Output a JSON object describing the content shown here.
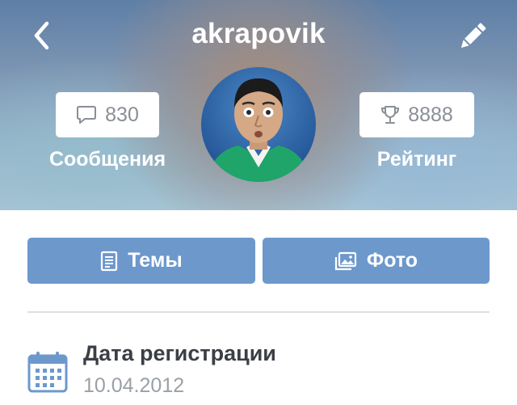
{
  "profile": {
    "username": "akrapovik"
  },
  "stats": {
    "messages": {
      "count": "830",
      "label": "Сообщения",
      "icon": "speech-bubble-icon"
    },
    "rating": {
      "count": "8888",
      "label": "Рейтинг",
      "icon": "trophy-icon"
    }
  },
  "tabs": [
    {
      "label": "Темы",
      "icon": "document-icon"
    },
    {
      "label": "Фото",
      "icon": "photo-icon"
    }
  ],
  "info": {
    "label": "Дата регистрации",
    "value": "10.04.2012",
    "icon": "calendar-icon"
  },
  "colors": {
    "accent": "#6d98cc",
    "text_primary": "#3a3f45",
    "text_secondary": "#9aa0a7"
  }
}
